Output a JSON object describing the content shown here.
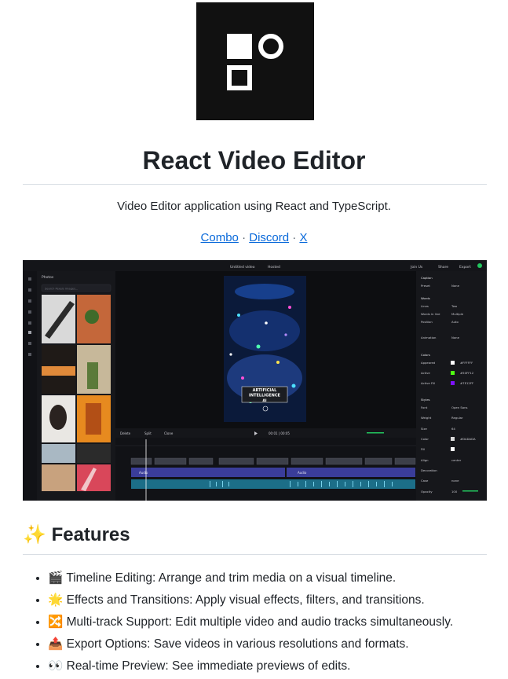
{
  "header": {
    "title": "React Video Editor",
    "subtitle": "Video Editor application using React and TypeScript.",
    "links": [
      {
        "label": "Combo"
      },
      {
        "label": "Discord"
      },
      {
        "label": "X"
      }
    ],
    "separator": "·"
  },
  "screenshot": {
    "top_bar": {
      "project_name": "Untitled video",
      "badge": "Hosted",
      "join_us": "Join Us",
      "share": "Share",
      "export": "Export"
    },
    "left_panel": {
      "title": "Photos",
      "search_placeholder": "Search Pexels images..."
    },
    "preview_overlay": {
      "line1": "ARTIFICIAL",
      "line2": "INTELLIGENCE",
      "line3": "AI"
    },
    "timeline_toolbar": {
      "delete": "Delete",
      "split": "Split",
      "clone": "Clone",
      "time": "00:01 | 00:05"
    },
    "timeline_tracks": {
      "audio_label_1": "Audio",
      "audio_label_2": "Audio"
    },
    "right_panel": {
      "caption_header": "Caption",
      "preset_label": "Preset",
      "preset_value": "None",
      "words_header": "Words",
      "lines_label": "Lines",
      "lines_value": "Two",
      "words_label": "Words in line",
      "words_value": "Multiple",
      "position_label": "Position",
      "position_value": "Auto",
      "animation_label": "Animation",
      "animation_value": "None",
      "colors_header": "Colors",
      "appeared_label": "Appeared",
      "appeared_value": "#FFFFFF",
      "active_label": "Active",
      "active_value": "#50FF12",
      "activefill_label": "Active Fill",
      "activefill_value": "#7E12FF",
      "styles_header": "Styles",
      "font_label": "Font",
      "font_value": "Open Sans",
      "weight_label": "Weight",
      "weight_value": "Regular",
      "size_label": "Size",
      "size_value": "64",
      "color_label": "Color",
      "color_value": "#DADADA",
      "fill_label": "Fill",
      "align_label": "Align",
      "align_value": "center",
      "decoration_label": "Decoration",
      "case_label": "Case",
      "case_value": "none",
      "opacity_label": "Opacity",
      "opacity_value": "100"
    },
    "colors": {
      "appeared": "#ffffff",
      "active": "#50ff12",
      "active_fill": "#7e12ff",
      "accent": "#22c55e"
    }
  },
  "features": {
    "heading_icon": "✨",
    "heading": "Features",
    "items": [
      {
        "icon": "🎬",
        "text": "Timeline Editing: Arrange and trim media on a visual timeline."
      },
      {
        "icon": "🌟",
        "text": "Effects and Transitions: Apply visual effects, filters, and transitions."
      },
      {
        "icon": "🔀",
        "text": "Multi-track Support: Edit multiple video and audio tracks simultaneously."
      },
      {
        "icon": "📤",
        "text": "Export Options: Save videos in various resolutions and formats."
      },
      {
        "icon": "👀",
        "text": "Real-time Preview: See immediate previews of edits."
      }
    ]
  }
}
